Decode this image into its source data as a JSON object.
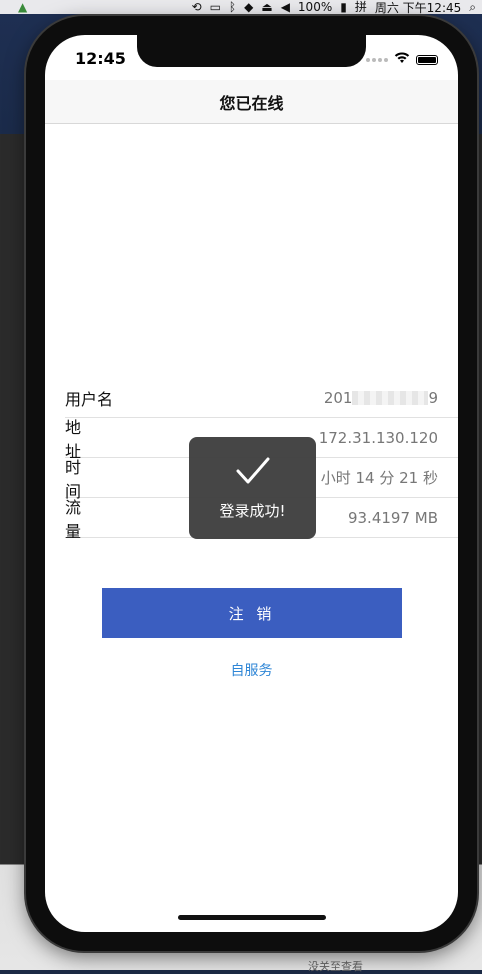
{
  "menubar": {
    "battery_percent": "100%",
    "input_method": "拼",
    "datetime": "周六 下午12:45"
  },
  "phone": {
    "status_time": "12:45"
  },
  "navbar": {
    "title": "您已在线"
  },
  "info": {
    "rows": [
      {
        "label": "用户名",
        "value_prefix": "201",
        "value_suffix": "9"
      },
      {
        "label": "地 址",
        "value": "172.31.130.120"
      },
      {
        "label": "时 间",
        "value": "小时 14 分 21 秒"
      },
      {
        "label": "流 量",
        "value": "93.4197 MB"
      }
    ]
  },
  "buttons": {
    "logout_label": "注 销",
    "self_service_label": "自服务"
  },
  "toast": {
    "message": "登录成功!"
  },
  "desktop": {
    "bottom_text": "没关至查看"
  },
  "icons": {
    "check": "check-icon",
    "wifi": "wifi-icon",
    "battery": "battery-icon"
  },
  "colors": {
    "primary": "#3b5ec0",
    "link": "#2f86d6"
  }
}
